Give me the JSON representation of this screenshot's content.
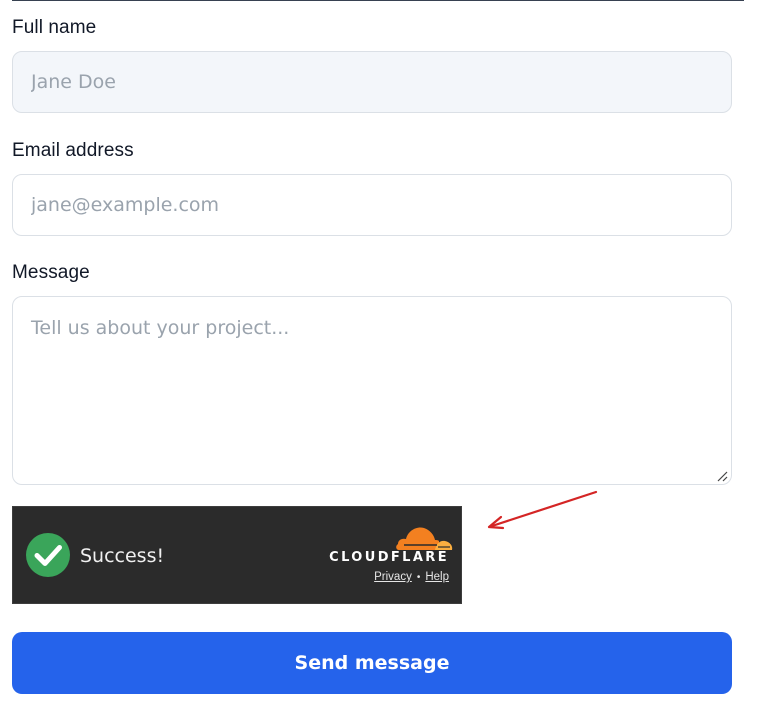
{
  "form": {
    "name": {
      "label": "Full name",
      "value": "",
      "placeholder": "Jane Doe"
    },
    "email": {
      "label": "Email address",
      "value": "",
      "placeholder": "jane@example.com"
    },
    "message": {
      "label": "Message",
      "value": "",
      "placeholder": "Tell us about your project..."
    },
    "submit_label": "Send message"
  },
  "captcha": {
    "status_text": "Success!",
    "provider": "CLOUDFLARE",
    "privacy_label": "Privacy",
    "separator": "•",
    "help_label": "Help",
    "icons": {
      "status": "check-circle-icon",
      "logo": "cloudflare-cloud-icon"
    }
  },
  "annotation": {
    "icon": "red-arrow-icon",
    "color": "#d42525"
  },
  "colors": {
    "accent": "#2563eb",
    "success": "#3aa55a",
    "cloudflare_orange": "#f38020",
    "captcha_bg": "#2b2b2b"
  }
}
